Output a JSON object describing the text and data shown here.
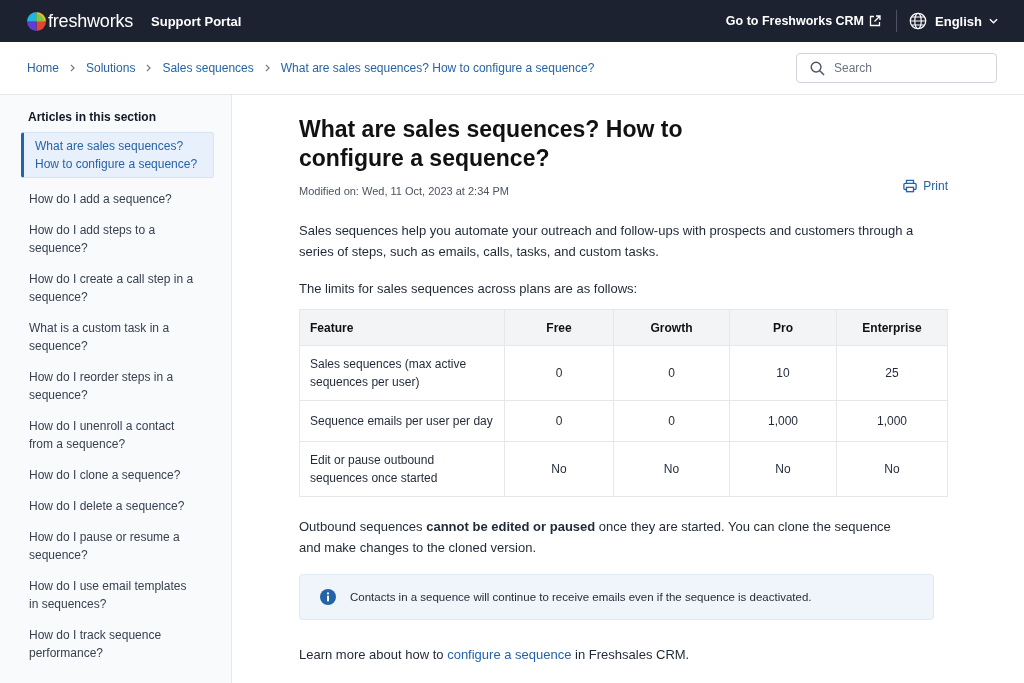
{
  "header": {
    "logo_text": "freshworks",
    "portal_title": "Support Portal",
    "crm_link": "Go to Freshworks CRM",
    "language": "English"
  },
  "breadcrumbs": [
    "Home",
    "Solutions",
    "Sales sequences",
    "What are sales sequences? How to configure a sequence?"
  ],
  "search": {
    "placeholder": "Search"
  },
  "sidebar": {
    "heading": "Articles in this section",
    "items": [
      {
        "label": "What are sales sequences? How to configure a sequence?",
        "selected": true
      },
      {
        "label": "How do I add a sequence?",
        "selected": false
      },
      {
        "label": "How do I add steps to a sequence?",
        "selected": false
      },
      {
        "label": "How do I create a call step in a sequence?",
        "selected": false
      },
      {
        "label": "What is a custom task in a sequence?",
        "selected": false
      },
      {
        "label": "How do I reorder steps in a sequence?",
        "selected": false
      },
      {
        "label": "How do I unenroll a contact from a sequence?",
        "selected": false
      },
      {
        "label": "How do I clone a sequence?",
        "selected": false
      },
      {
        "label": "How do I delete a sequence?",
        "selected": false
      },
      {
        "label": "How do I pause or resume a sequence?",
        "selected": false
      },
      {
        "label": "How do I use email templates in sequences?",
        "selected": false
      },
      {
        "label": "How do I track sequence performance?",
        "selected": false
      }
    ]
  },
  "article": {
    "title": "What are sales sequences? How to configure a sequence?",
    "modified": "Modified on: Wed, 11 Oct, 2023 at 2:34 PM",
    "print": "Print",
    "intro": "Sales sequences help you automate your outreach and follow-ups with prospects and customers through a series of steps, such as emails, calls, tasks, and custom tasks.",
    "limits_intro": "The limits for sales sequences across plans are as follows:",
    "table": {
      "columns": [
        "Feature",
        "Free",
        "Growth",
        "Pro",
        "Enterprise"
      ],
      "rows": [
        [
          "Sales sequences (max active sequences per user)",
          "0",
          "0",
          "10",
          "25"
        ],
        [
          "Sequence emails per user per day",
          "0",
          "0",
          "1,000",
          "1,000"
        ],
        [
          "Edit or pause outbound sequences once started",
          "No",
          "No",
          "No",
          "No"
        ]
      ]
    },
    "outbound_note": "Outbound sequences **cannot be edited or paused** once they are started. You can clone the sequence and make changes to the cloned version.",
    "info_note": "Contacts in a sequence will continue to receive emails even if the sequence is deactivated.",
    "learn_more": {
      "before": "Learn more about how to ",
      "link": "configure a sequence",
      "after": " in Freshsales CRM."
    }
  }
}
